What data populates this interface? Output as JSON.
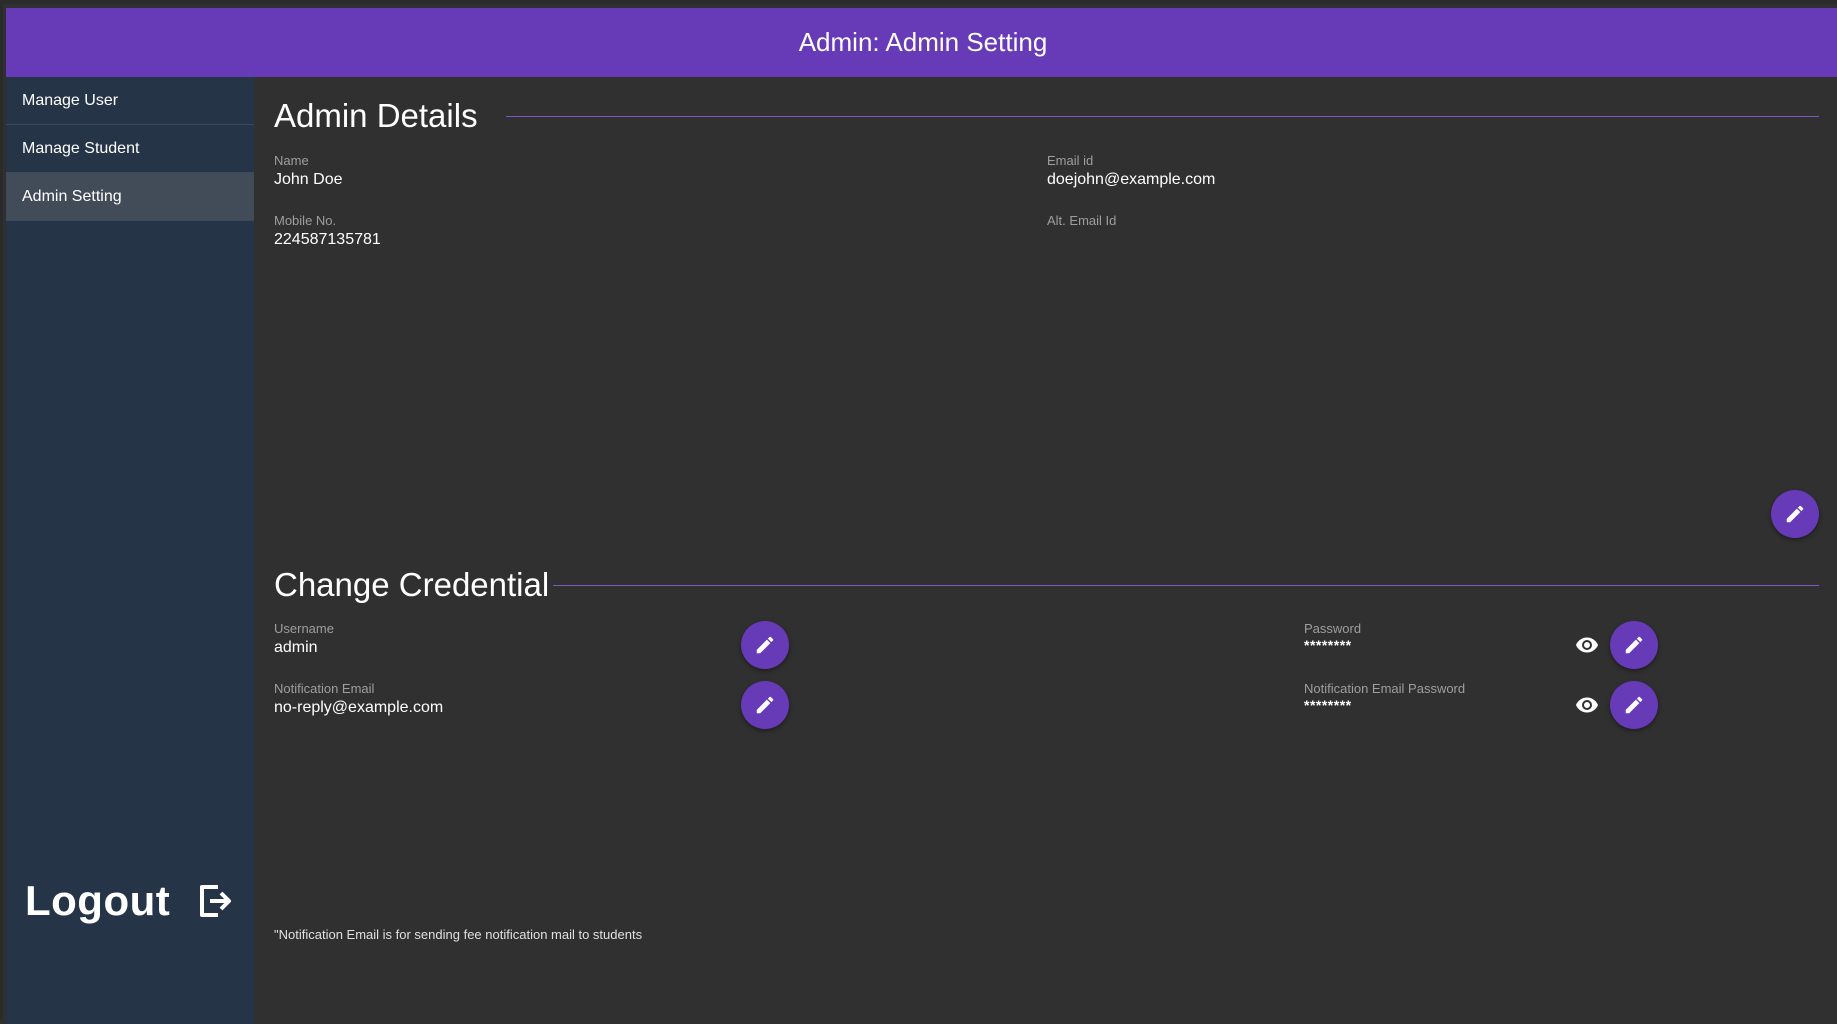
{
  "header": {
    "title": "Admin: Admin Setting"
  },
  "sidebar": {
    "items": [
      {
        "label": "Manage User"
      },
      {
        "label": "Manage Student"
      },
      {
        "label": "Admin Setting"
      }
    ],
    "active_item": "Admin Setting",
    "logout_label": "Logout"
  },
  "admin_details": {
    "title": "Admin Details",
    "name_label": "Name",
    "name_value": "John Doe",
    "email_label": "Email id",
    "email_value": "doejohn@example.com",
    "mobile_label": "Mobile No.",
    "mobile_value": "224587135781",
    "alt_email_label": "Alt. Email Id",
    "alt_email_value": ""
  },
  "credentials": {
    "title": "Change Credential",
    "username_label": "Username",
    "username_value": "admin",
    "notif_email_label": "Notification Email",
    "notif_email_value": "no-reply@example.com",
    "password_label": "Password",
    "password_value": "********",
    "notif_password_label": "Notification Email Password",
    "notif_password_value": "********"
  },
  "footnote": "\"Notification Email is for sending fee notification mail to students",
  "colors": {
    "accent": "#673ab7",
    "sidebar_bg": "#253447",
    "sidebar_active": "#424c59",
    "content_bg": "#303030"
  },
  "icons": [
    "edit-icon",
    "eye-icon",
    "logout-icon"
  ]
}
